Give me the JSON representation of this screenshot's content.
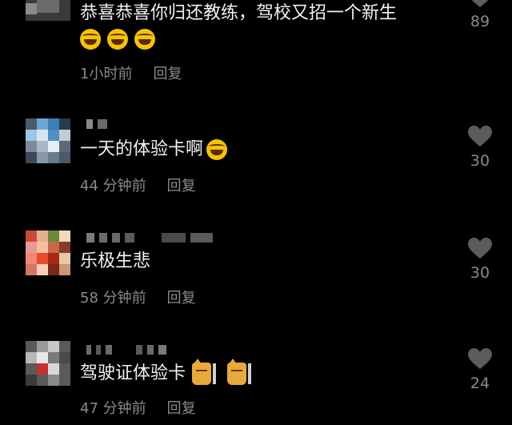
{
  "comments": [
    {
      "text": "恭喜恭喜你归还教练，驾校又招一个新生",
      "time": "1小时前",
      "reply": "回复",
      "likes": "89"
    },
    {
      "text": "一天的体验卡啊",
      "time": "44 分钟前",
      "reply": "回复",
      "likes": "30"
    },
    {
      "text": "乐极生悲",
      "time": "58 分钟前",
      "reply": "回复",
      "likes": "30"
    },
    {
      "text": "驾驶证体验卡",
      "time": "47 分钟前",
      "reply": "回复",
      "likes": "24"
    }
  ],
  "icons": {
    "like": "heart-icon",
    "laugh": "laughing-tears-emoji",
    "cat": "cat-emoji"
  },
  "colors": {
    "background": "#000000",
    "text": "#f2f2f2",
    "meta": "#8a8a8a",
    "heart": "#5c5c5c"
  }
}
